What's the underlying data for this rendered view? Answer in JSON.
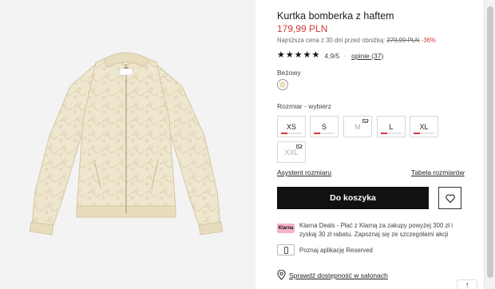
{
  "product": {
    "title": "Kurtka bomberka z haftem",
    "price": "179,99 PLN",
    "lowest_price_label": "Najniższa cena z 30 dni przed obniżką:",
    "old_price": "279,99 PLN",
    "discount": "-36%",
    "rating": "4,9/5",
    "rating_dot": "·",
    "reviews": "opinie (37)",
    "color_label": "Beżowy",
    "swatch_color": "#efe0c2"
  },
  "sizes": {
    "label": "Rozmiar -  wybierz",
    "items": [
      {
        "label": "XS",
        "available": true,
        "mail": false
      },
      {
        "label": "S",
        "available": true,
        "mail": false
      },
      {
        "label": "M",
        "available": false,
        "mail": true
      },
      {
        "label": "L",
        "available": true,
        "mail": false
      },
      {
        "label": "XL",
        "available": true,
        "mail": false
      },
      {
        "label": "XXL",
        "available": false,
        "mail": true
      }
    ]
  },
  "links": {
    "size_assistant": "Asystent rozmiaru",
    "size_table": "Tabela rozmiarów"
  },
  "actions": {
    "add_to_cart": "Do koszyka"
  },
  "klarna": {
    "badge": "Klarna",
    "text": "Klarna Deals - Płać z Klarną za zakupy powyżej 300 zł i zyskaj 30 zł rabatu. Zapoznaj się ze szczegółami akcji"
  },
  "app": {
    "text": "Poznaj aplikację Reserved"
  },
  "store": {
    "text": "Sprawdź dostępność w salonach"
  },
  "scroll_up": "↑",
  "colors": {
    "accent_red": "#d23a3a",
    "cart_button": "#111111",
    "klarna_pink": "#f4b3c7",
    "jacket": "#efe6cf"
  }
}
